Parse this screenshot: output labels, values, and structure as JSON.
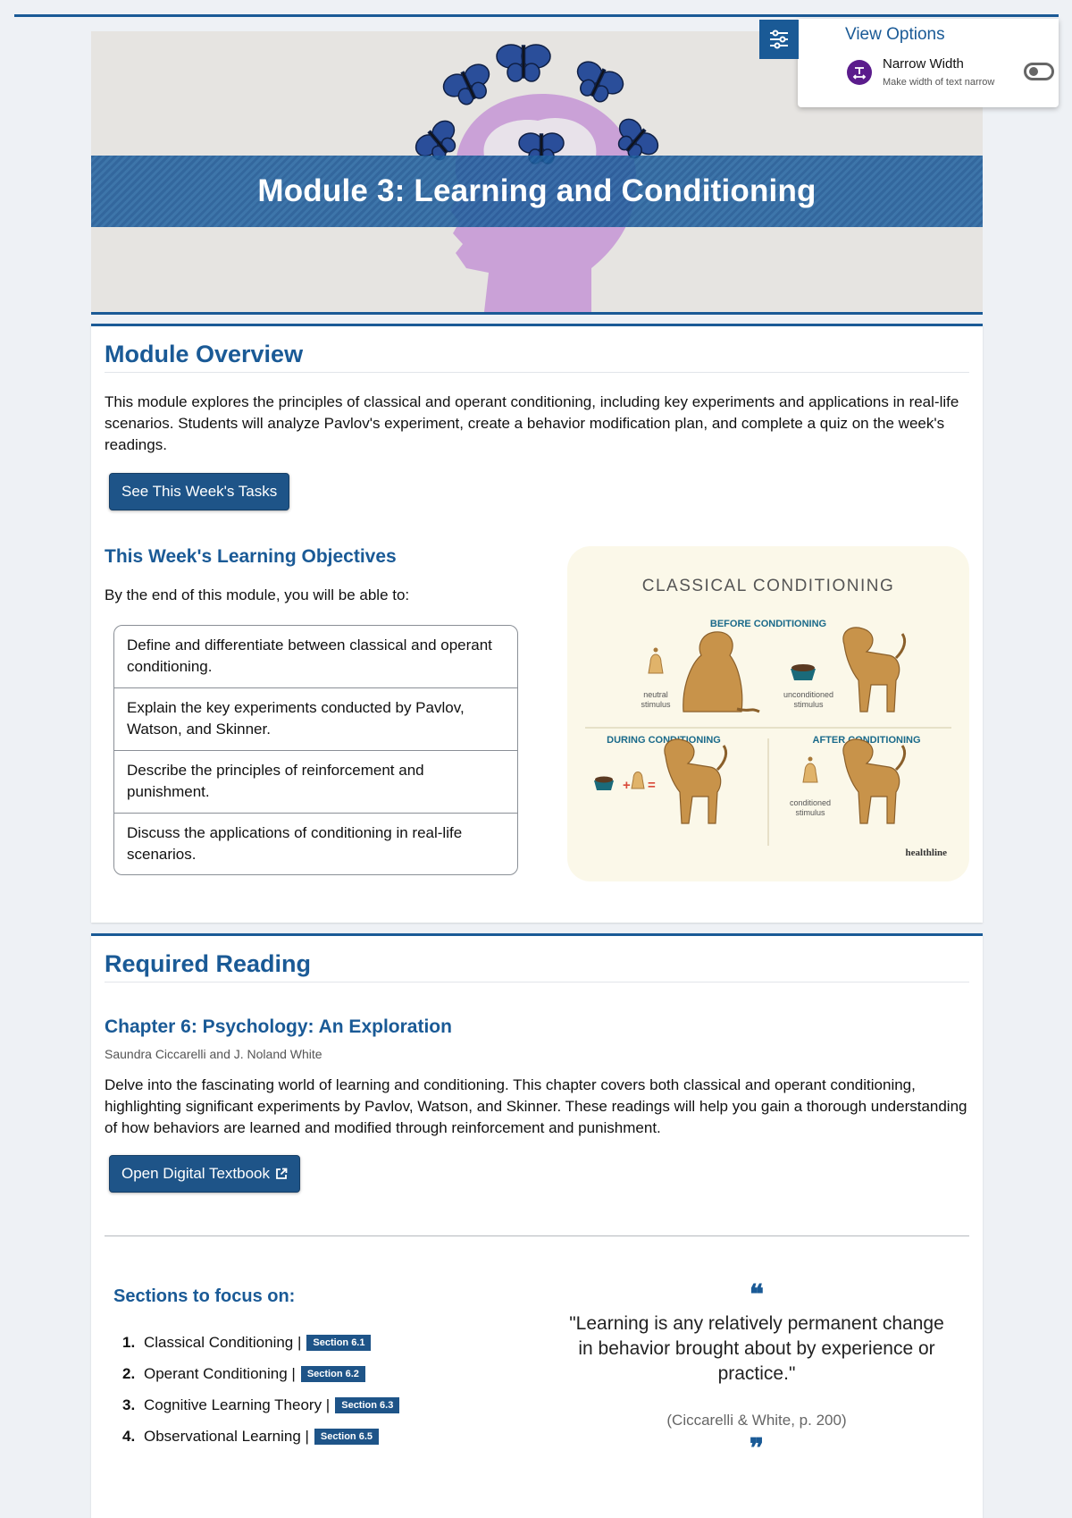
{
  "banner": {
    "title": "Module 3: Learning and Conditioning"
  },
  "view_options": {
    "title": "View Options",
    "toggle_label": "Narrow Width",
    "toggle_description": "Make width of text narrow",
    "toggle_on": false
  },
  "overview": {
    "heading": "Module Overview",
    "body": "This module explores the principles of classical and operant conditioning, including key experiments and applications in real-life scenarios. Students will analyze Pavlov's experiment, create a behavior modification plan, and complete a quiz on the week's readings.",
    "tasks_button": "See This Week's Tasks",
    "objectives_heading": "This Week's Learning Objectives",
    "objectives_intro": "By the end of this module, you will be able to:",
    "objectives": [
      "Define and differentiate between classical and operant conditioning.",
      "Explain the key experiments conducted by Pavlov, Watson, and Skinner.",
      "Describe the principles of reinforcement and punishment.",
      "Discuss the applications of conditioning in real-life scenarios."
    ],
    "diagram": {
      "title": "CLASSICAL CONDITIONING",
      "before": "BEFORE CONDITIONING",
      "during": "DURING CONDITIONING",
      "after": "AFTER CONDITIONING",
      "neutral_1": "neutral",
      "neutral_2": "stimulus",
      "uncond_1": "unconditioned",
      "uncond_2": "stimulus",
      "cond_1": "conditioned",
      "cond_2": "stimulus",
      "credit": "healthline"
    }
  },
  "reading": {
    "heading": "Required Reading",
    "chapter_title": "Chapter 6: Psychology: An Exploration",
    "authors": "Saundra Ciccarelli and J. Noland White",
    "body": "Delve into the fascinating world of learning and conditioning. This chapter covers both classical and operant conditioning, highlighting significant experiments by Pavlov, Watson, and Skinner. These readings will help you gain a thorough understanding of how behaviors are learned and modified through reinforcement and punishment.",
    "textbook_button": "Open Digital Textbook",
    "sections_heading": "Sections to focus on:",
    "sections": [
      {
        "num": "1.",
        "label": "Classical Conditioning |",
        "badge": "Section 6.1"
      },
      {
        "num": "2.",
        "label": "Operant Conditioning |",
        "badge": "Section 6.2"
      },
      {
        "num": "3.",
        "label": "Cognitive Learning Theory |",
        "badge": "Section 6.3"
      },
      {
        "num": "4.",
        "label": "Observational Learning |",
        "badge": "Section 6.5"
      }
    ],
    "quote_open": "❝",
    "quote_text": "\"Learning is any relatively permanent change in behavior brought about by experience or practice.\"",
    "quote_citation": "(Ciccarelli & White, p. 200)",
    "quote_close": "❞"
  },
  "colors": {
    "brand": "#1a5a96",
    "button": "#1e5488",
    "head_silhouette": "#c89bd6",
    "butterfly": "#2a4e9a"
  }
}
